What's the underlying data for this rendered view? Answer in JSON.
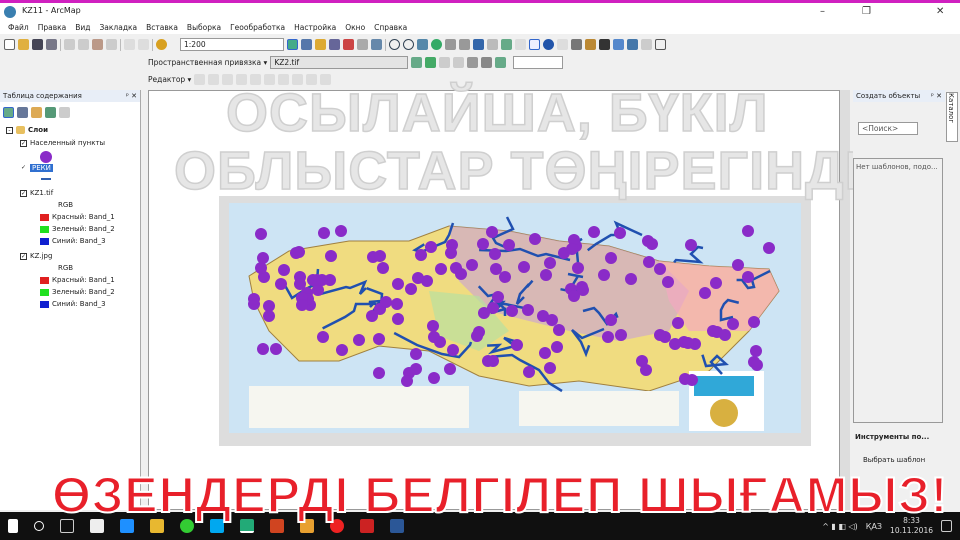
{
  "window": {
    "title": "KZ11 - ArcMap",
    "min": "–",
    "max": "❐",
    "close": "✕"
  },
  "menu": [
    "Файл",
    "Правка",
    "Вид",
    "Закладка",
    "Вставка",
    "Выборка",
    "Геообработка",
    "Настройка",
    "Окно",
    "Справка"
  ],
  "toolbar": {
    "scale": "1:200",
    "georef_label": "Пространственная привязка ▾",
    "georef_layer": "KZ2.tif",
    "editor_label": "Редактор ▾"
  },
  "toc": {
    "title": "Таблица содержания",
    "pin": "ᵖ ✕",
    "root": "Слои",
    "layers": [
      {
        "name": "Населенный пункты"
      },
      {
        "name": "РЕКИ"
      },
      {
        "name": "KZ1.tif",
        "rgb": "RGB",
        "bands": [
          "Красный: Band_1",
          "Зеленый: Band_2",
          "Синий: Band_3"
        ]
      },
      {
        "name": "KZ.jpg",
        "rgb": "RGB",
        "bands": [
          "Красный: Band_1",
          "Зеленый: Band_2",
          "Синий: Band_3"
        ]
      }
    ]
  },
  "right": {
    "title": "Создать объекты",
    "search": "<Поиск>",
    "message": "Нет шаблонов, подо...",
    "tools_title": "Инструменты по...",
    "tools_text": "Выбрать шаблон",
    "tab": "Каталог"
  },
  "overlay": {
    "line1": "ОСЫЛАЙША, БҮКІЛ",
    "line2": "ОБЛЫСТАР ТӨҢІРЕГІНДЕ",
    "bottom": "ӨЗЕНДЕРДІ БЕЛГІЛЕП ШЫҒАМЫЗ!"
  },
  "taskbar": {
    "lang": "ҚАЗ",
    "time": "8:33",
    "date": "10.11.2016"
  },
  "colors": {
    "dot": "#8a2bc8",
    "river": "#2050b0",
    "overlay_red": "#e8202a"
  }
}
